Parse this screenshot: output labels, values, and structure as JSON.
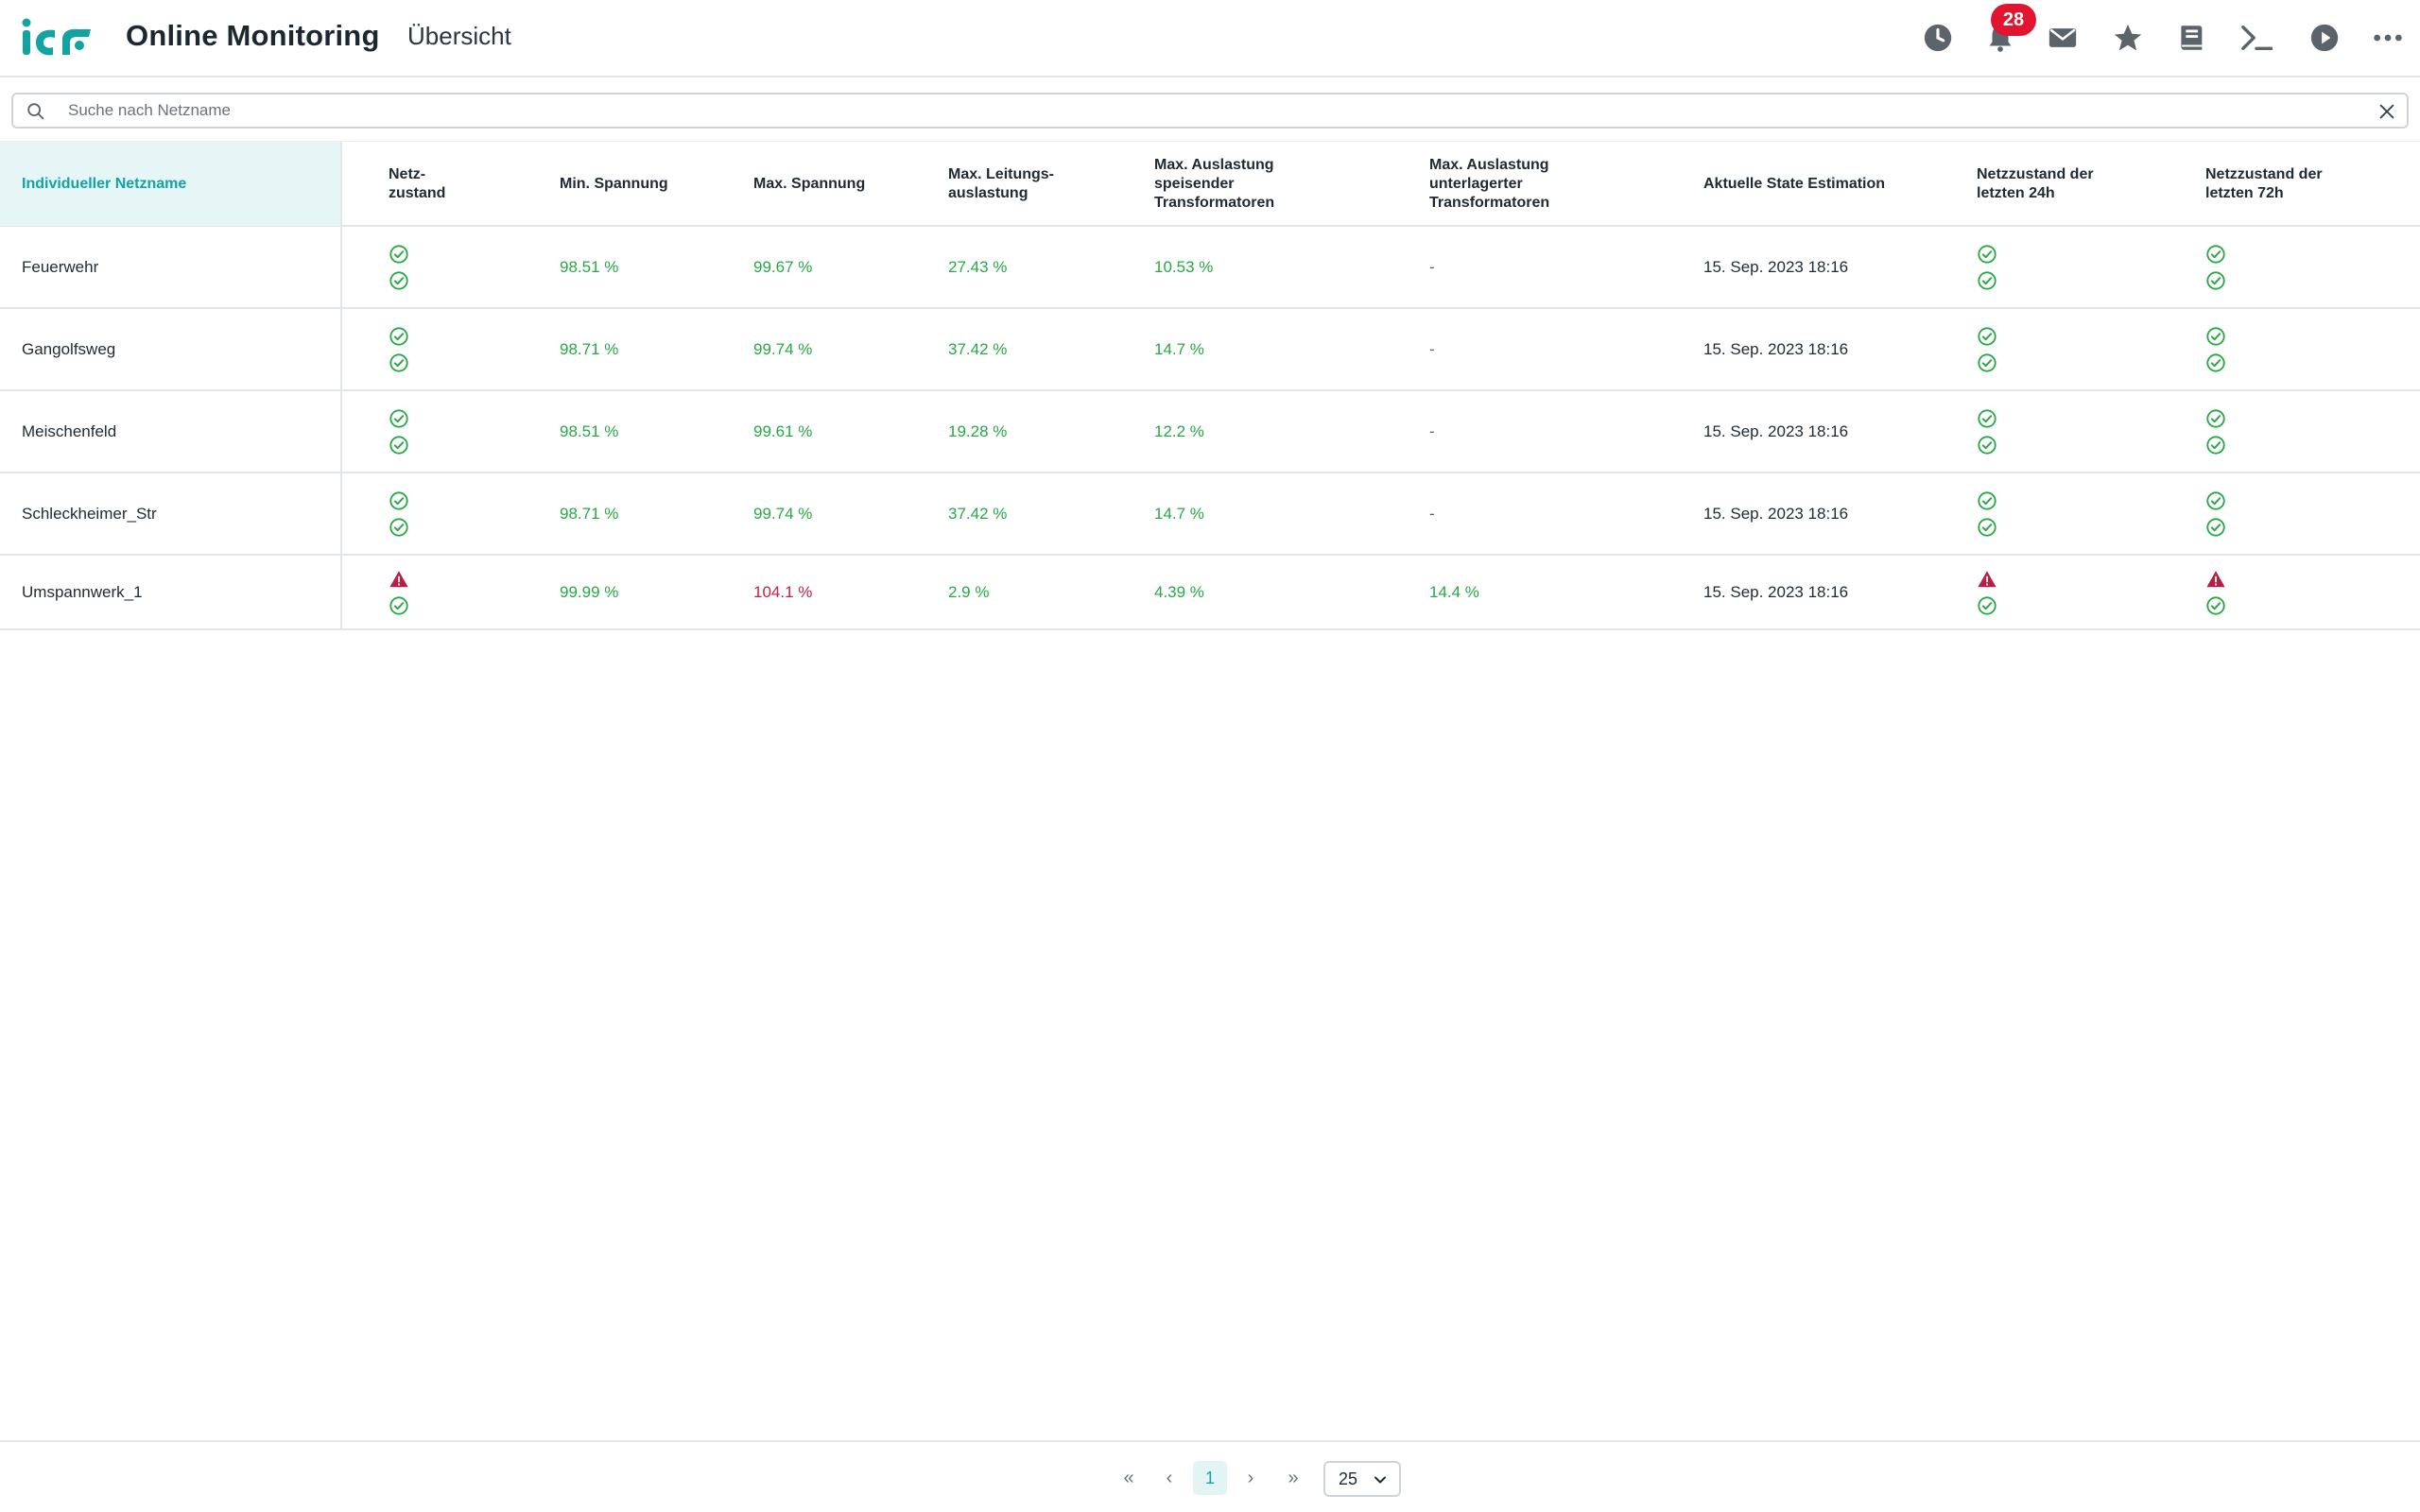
{
  "header": {
    "app_title": "Online Monitoring",
    "page_title": "Übersicht",
    "notification_count": "28",
    "icons": [
      "history-icon",
      "bell-icon",
      "mail-icon",
      "star-icon",
      "book-icon",
      "terminal-icon",
      "play-icon",
      "more-icon"
    ]
  },
  "search": {
    "placeholder": "Suche nach Netzname",
    "value": ""
  },
  "table": {
    "columns": [
      {
        "key": "name",
        "label": "Individueller Netzname"
      },
      {
        "key": "state",
        "label": "Netz-\nzustand"
      },
      {
        "key": "min_v",
        "label": "Min. Spannung"
      },
      {
        "key": "max_v",
        "label": "Max. Spannung"
      },
      {
        "key": "max_line",
        "label": "Max. Leitungs-\nauslastung"
      },
      {
        "key": "max_feed",
        "label": "Max. Auslastung\nspeisender\nTransformatoren"
      },
      {
        "key": "max_sub",
        "label": "Max. Auslastung\nunterlagerter\nTransformatoren"
      },
      {
        "key": "estimation",
        "label": "Aktuelle State Estimation"
      },
      {
        "key": "state_24h",
        "label": "Netzzustand der\nletzten 24h"
      },
      {
        "key": "state_72h",
        "label": "Netzzustand der\nletzten 72h"
      }
    ],
    "rows": [
      {
        "name": "Feuerwehr",
        "state": [
          "ok",
          "ok"
        ],
        "min_v": "98.51 %",
        "max_v": "99.67 %",
        "max_v_status": "green",
        "max_line": "27.43 %",
        "max_feed": "10.53 %",
        "max_sub": "-",
        "estimation": "15. Sep. 2023 18:16",
        "state_24h": [
          "ok",
          "ok"
        ],
        "state_72h": [
          "ok",
          "ok"
        ]
      },
      {
        "name": "Gangolfsweg",
        "state": [
          "ok",
          "ok"
        ],
        "min_v": "98.71 %",
        "max_v": "99.74 %",
        "max_v_status": "green",
        "max_line": "37.42 %",
        "max_feed": "14.7 %",
        "max_sub": "-",
        "estimation": "15. Sep. 2023 18:16",
        "state_24h": [
          "ok",
          "ok"
        ],
        "state_72h": [
          "ok",
          "ok"
        ]
      },
      {
        "name": "Meischenfeld",
        "state": [
          "ok",
          "ok"
        ],
        "min_v": "98.51 %",
        "max_v": "99.61 %",
        "max_v_status": "green",
        "max_line": "19.28 %",
        "max_feed": "12.2 %",
        "max_sub": "-",
        "estimation": "15. Sep. 2023 18:16",
        "state_24h": [
          "ok",
          "ok"
        ],
        "state_72h": [
          "ok",
          "ok"
        ]
      },
      {
        "name": "Schleckheimer_Str",
        "state": [
          "ok",
          "ok"
        ],
        "min_v": "98.71 %",
        "max_v": "99.74 %",
        "max_v_status": "green",
        "max_line": "37.42 %",
        "max_feed": "14.7 %",
        "max_sub": "-",
        "estimation": "15. Sep. 2023 18:16",
        "state_24h": [
          "ok",
          "ok"
        ],
        "state_72h": [
          "ok",
          "ok"
        ]
      },
      {
        "name": "Umspannwerk_1",
        "state": [
          "warning",
          "ok"
        ],
        "min_v": "99.99 %",
        "max_v": "104.1 %",
        "max_v_status": "red",
        "max_line": "2.9 %",
        "max_feed": "4.39 %",
        "max_sub": "14.4 %",
        "estimation": "15. Sep. 2023 18:16",
        "state_24h": [
          "warning",
          "ok"
        ],
        "state_72h": [
          "warning",
          "ok"
        ]
      }
    ]
  },
  "pagination": {
    "first": "«",
    "prev": "‹",
    "current_page": "1",
    "next": "›",
    "last": "»",
    "page_size": "25"
  },
  "colors": {
    "accent": "#13a3a0",
    "ok": "#27a844",
    "warning": "#c81e45",
    "badge": "#e1152f"
  }
}
